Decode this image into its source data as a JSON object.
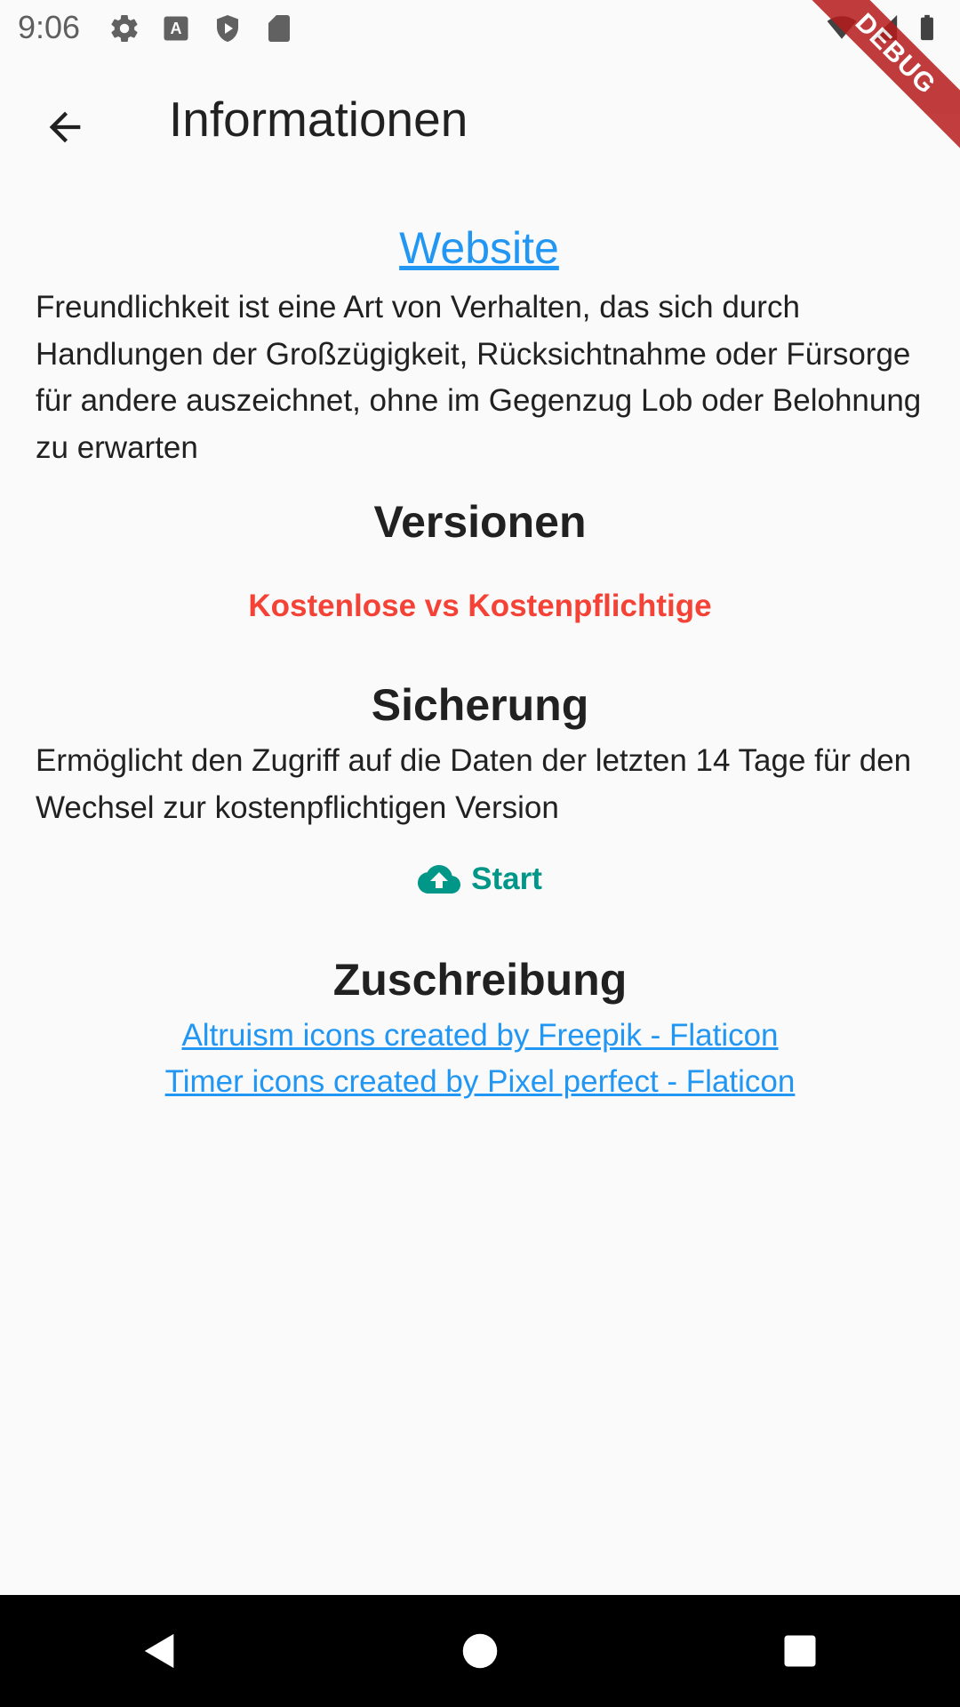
{
  "status_bar": {
    "time": "9:06",
    "left_icons": [
      "gear-icon",
      "a-icon",
      "shield-play-icon",
      "sd-card-icon"
    ],
    "right_icons": [
      "wifi-icon",
      "signal-icon",
      "battery-icon"
    ]
  },
  "debug_banner": "DEBUG",
  "app_bar": {
    "back_icon": "arrow-back-icon",
    "title": "Informationen"
  },
  "website_link": "Website",
  "description": "Freundlichkeit ist eine Art von Verhalten, das sich durch Handlungen der Großzügigkeit, Rücksichtnahme oder Fürsorge für andere auszeichnet, ohne im Gegenzug Lob oder Belohnung zu erwarten",
  "versions": {
    "title": "Versionen",
    "link": "Kostenlose vs Kostenpflichtige"
  },
  "backup": {
    "title": "Sicherung",
    "text": "Ermöglicht den Zugriff auf die Daten der letzten 14 Tage für den Wechsel zur kostenpflichtigen Version",
    "button_label": "Start",
    "button_icon": "cloud-upload-icon"
  },
  "attribution": {
    "title": "Zuschreibung",
    "links": [
      "Altruism icons created by Freepik - Flaticon",
      "Timer icons created by Pixel perfect - Flaticon"
    ]
  },
  "colors": {
    "link": "#2196f3",
    "versions": "#f44336",
    "start": "#009688",
    "background": "#fafafa"
  },
  "nav_bar": [
    "back-triangle-icon",
    "home-circle-icon",
    "recents-square-icon"
  ]
}
